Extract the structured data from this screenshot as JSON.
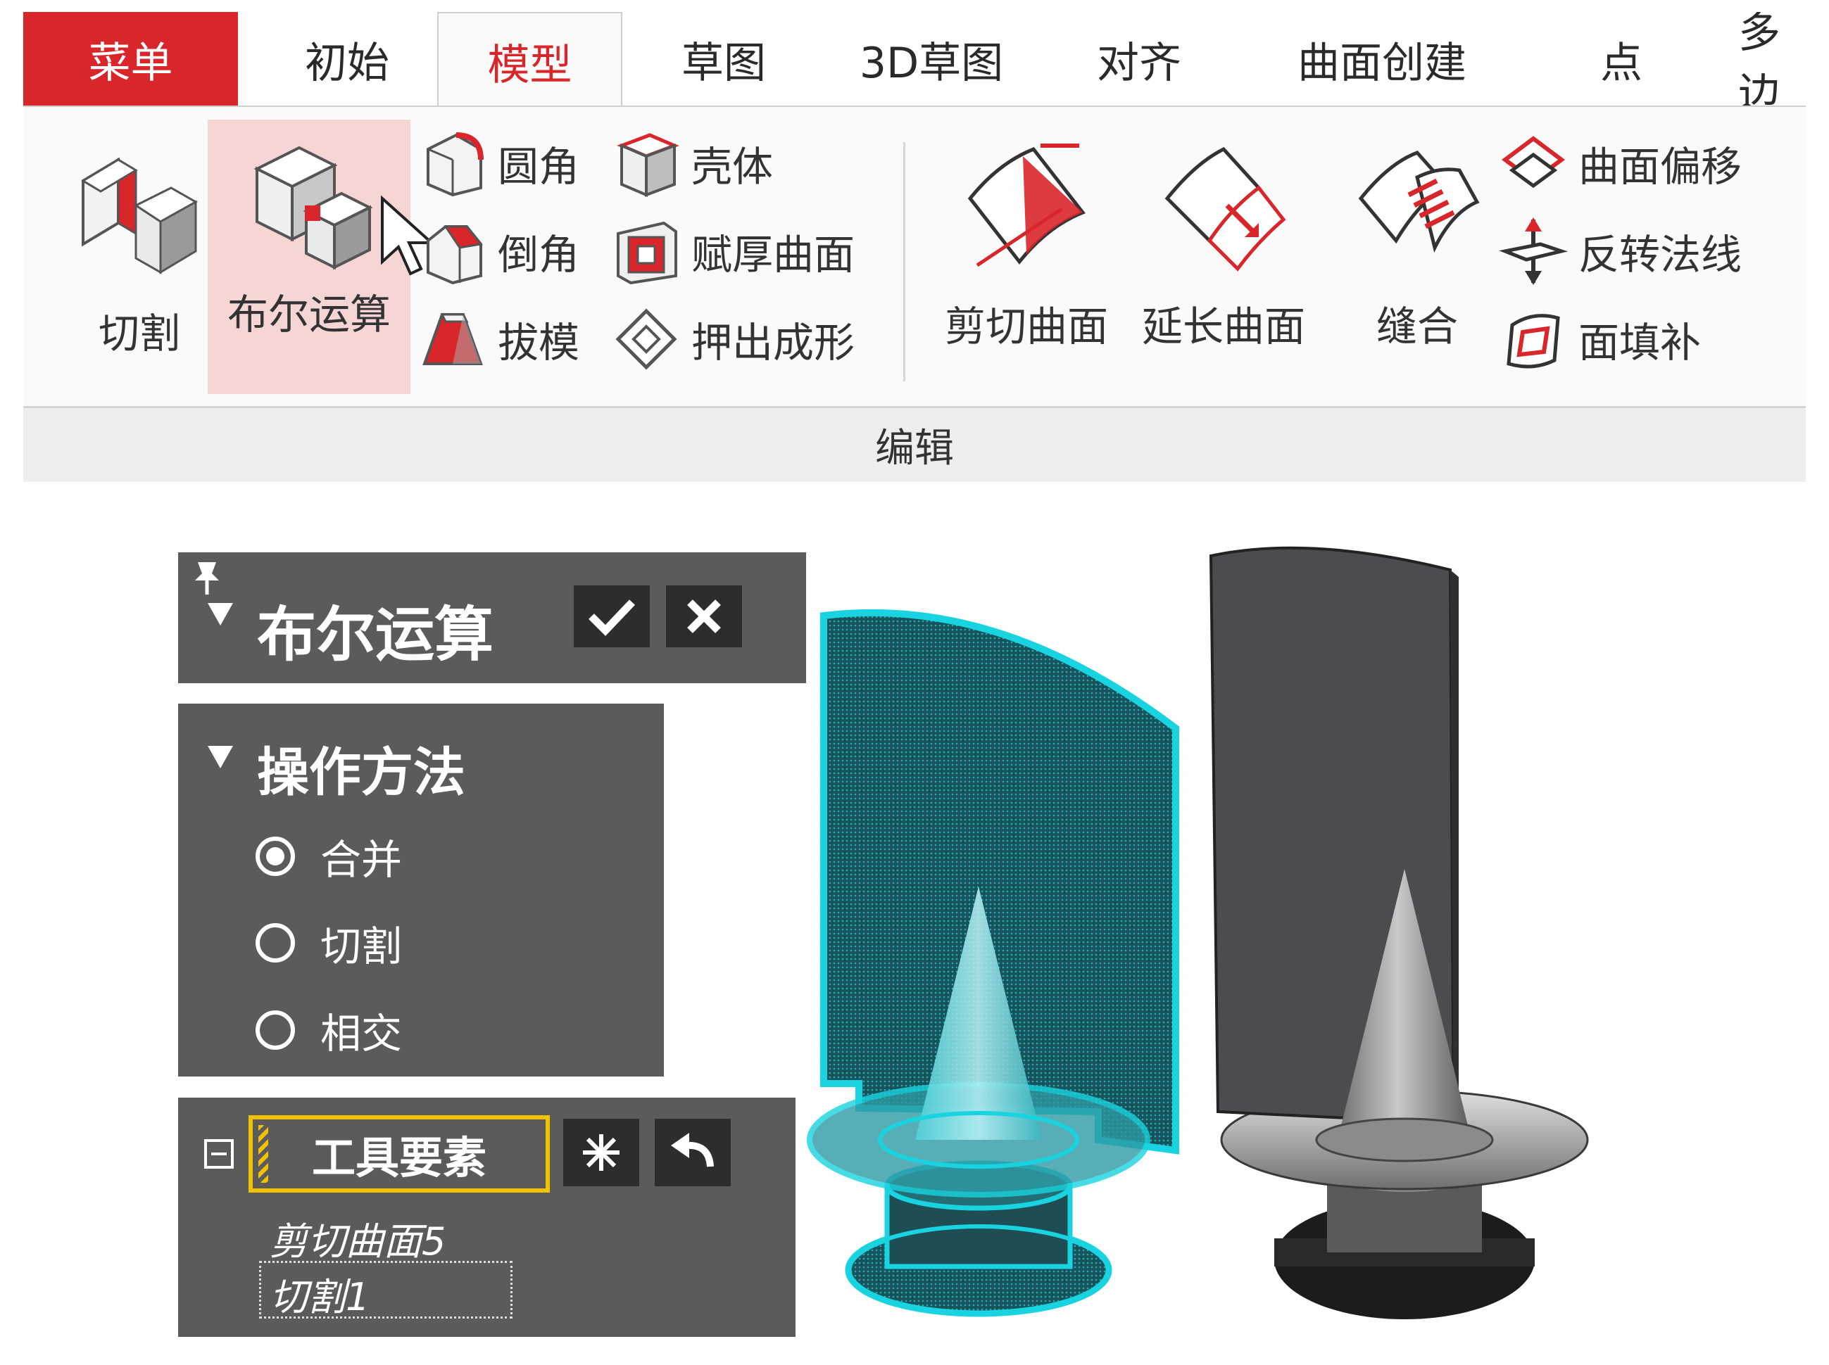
{
  "ribbon": {
    "tabs": [
      "菜单",
      "初始",
      "模型",
      "草图",
      "3D草图",
      "对齐",
      "曲面创建",
      "点",
      "多边"
    ],
    "active_tab": "模型",
    "large_buttons": {
      "cut": "切割",
      "boolean": "布尔运算",
      "trim_surface": "剪切曲面",
      "extend_surface": "延长曲面",
      "stitch": "缝合"
    },
    "small_buttons": {
      "fillet": "圆角",
      "chamfer": "倒角",
      "draft": "拔模",
      "shell": "壳体",
      "thicken": "赋厚曲面",
      "emboss": "押出成形",
      "offset_surface": "曲面偏移",
      "flip_normal": "反转法线",
      "fill_face": "面填补"
    },
    "group_label": "编辑"
  },
  "panel": {
    "title": "布尔运算",
    "section_title": "操作方法",
    "options": [
      "合并",
      "切割",
      "相交"
    ],
    "selected_option": "合并",
    "tool_field_label": "工具要素",
    "tool_items": [
      "剪切曲面5",
      "切割1"
    ]
  },
  "colors": {
    "accent_red": "#d9262b",
    "panel_bg": "#5b5b5b",
    "selection_cyan": "#19d4e0",
    "highlight_yellow": "#f2c200"
  }
}
